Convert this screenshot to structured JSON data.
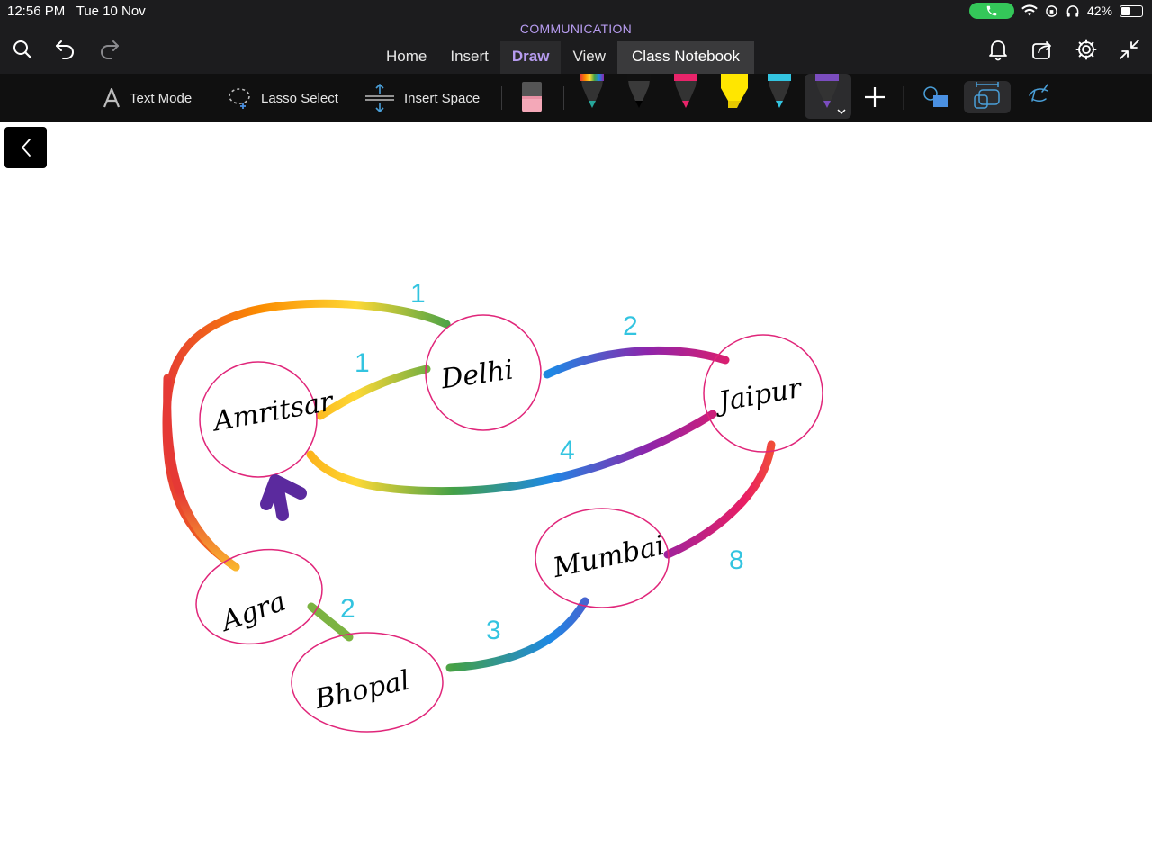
{
  "status": {
    "time": "12:56 PM",
    "date": "Tue 10 Nov",
    "battery": "42%"
  },
  "notebook_title": "COMMUNICATION",
  "tabs": [
    {
      "label": "Home"
    },
    {
      "label": "Insert"
    },
    {
      "label": "Draw"
    },
    {
      "label": "View"
    },
    {
      "label": "Class Notebook"
    }
  ],
  "active_tab": "Draw",
  "toolbar": {
    "text_mode": "Text Mode",
    "lasso_select": "Lasso Select",
    "insert_space": "Insert Space"
  },
  "pens": [
    {
      "name": "rainbow-pen",
      "color": "#8e5cc8"
    },
    {
      "name": "black-pen",
      "color": "#1a1a1a"
    },
    {
      "name": "pink-pen",
      "color": "#e8246a"
    },
    {
      "name": "yellow-highlighter",
      "color": "#ffe600"
    },
    {
      "name": "cyan-pen",
      "color": "#33c4e0"
    },
    {
      "name": "purple-pen",
      "color": "#7b4dbf",
      "selected": true
    }
  ],
  "drawing": {
    "cities": [
      "Amritsar",
      "Delhi",
      "Jaipur",
      "Agra",
      "Bhopal",
      "Mumbai"
    ],
    "edge_labels": [
      "1",
      "1",
      "2",
      "4",
      "8",
      "2",
      "3"
    ],
    "node_color": "#e0267a",
    "label_color": "#33c4e0"
  }
}
